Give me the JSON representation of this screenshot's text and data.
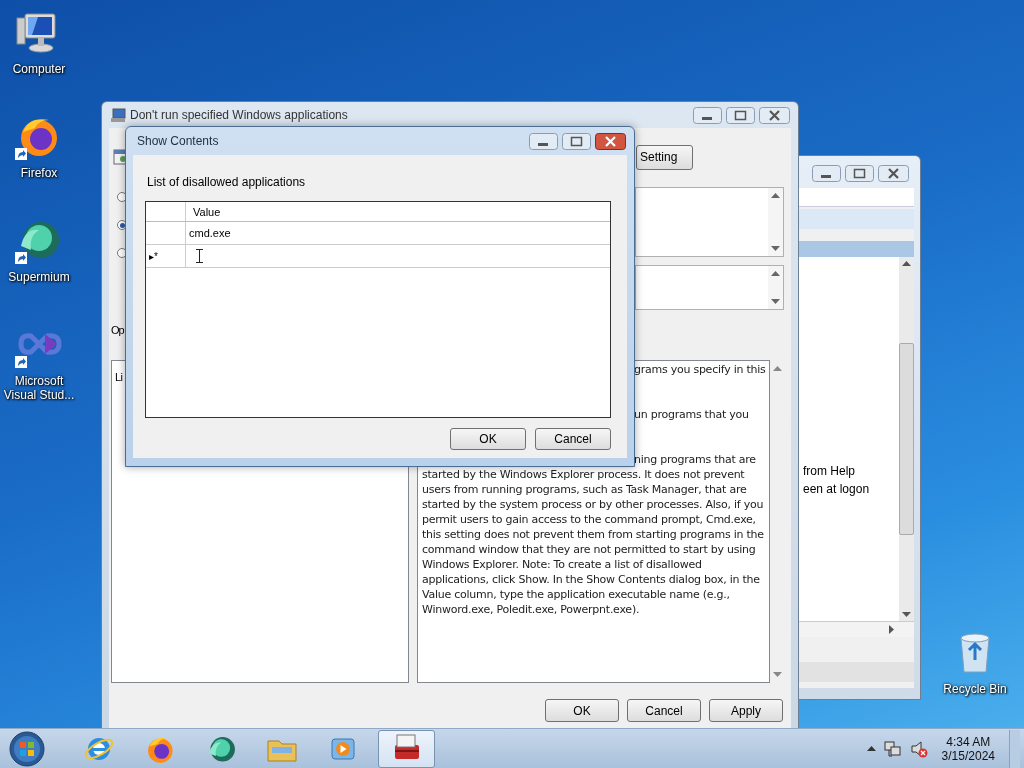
{
  "desktop_icons": [
    {
      "kind": "computer",
      "label": "Computer",
      "shortcut": false
    },
    {
      "kind": "firefox",
      "label": "Firefox",
      "shortcut": true
    },
    {
      "kind": "supermium",
      "label": "Supermium",
      "shortcut": true
    },
    {
      "kind": "visual-studio",
      "label": "Microsoft Visual Stud...",
      "shortcut": true
    },
    {
      "kind": "recycle-bin",
      "label": "Recycle Bin",
      "shortcut": false
    }
  ],
  "back_window": {
    "text_fragments": [
      "from Help",
      "een at logon"
    ]
  },
  "policy_window": {
    "title": "Don't run specified Windows applications",
    "partial_button": "Setting",
    "radios": [
      {
        "selected": false
      },
      {
        "selected": true
      },
      {
        "selected": false
      }
    ],
    "options_label": "Op",
    "options_box_text": "Li",
    "help_fragments": [
      "grams you specify in this",
      "un programs that you",
      "ning programs that are"
    ],
    "help_lines": [
      "started by the Windows Explorer process. It does not prevent",
      "users from running programs, such as Task Manager, that are",
      "started by the system process or by other processes. Also, if you",
      "permit users to gain access to the command prompt, Cmd.exe,",
      "this setting does not prevent them from starting programs in the",
      "command window that they are not permitted to start by using",
      "Windows Explorer. Note: To create a list of disallowed",
      "applications, click Show. In the Show Contents dialog box, in the",
      "Value column, type the application executable name (e.g.,",
      "Winword.exe, Poledit.exe, Powerpnt.exe)."
    ],
    "buttons": [
      "OK",
      "Cancel",
      "Apply"
    ]
  },
  "dialog": {
    "title": "Show Contents",
    "label": "List of disallowed applications",
    "column": "Value",
    "rows": [
      "cmd.exe"
    ],
    "new_row_marker": "▸*",
    "buttons": [
      "OK",
      "Cancel"
    ]
  },
  "taskbar": {
    "apps": [
      {
        "kind": "ie",
        "active": false
      },
      {
        "kind": "firefox",
        "active": false
      },
      {
        "kind": "supermium",
        "active": false
      },
      {
        "kind": "explorer",
        "active": false
      },
      {
        "kind": "media",
        "active": false
      },
      {
        "kind": "toolbox",
        "active": true
      }
    ],
    "time": "4:34 AM",
    "date": "3/15/2024"
  }
}
